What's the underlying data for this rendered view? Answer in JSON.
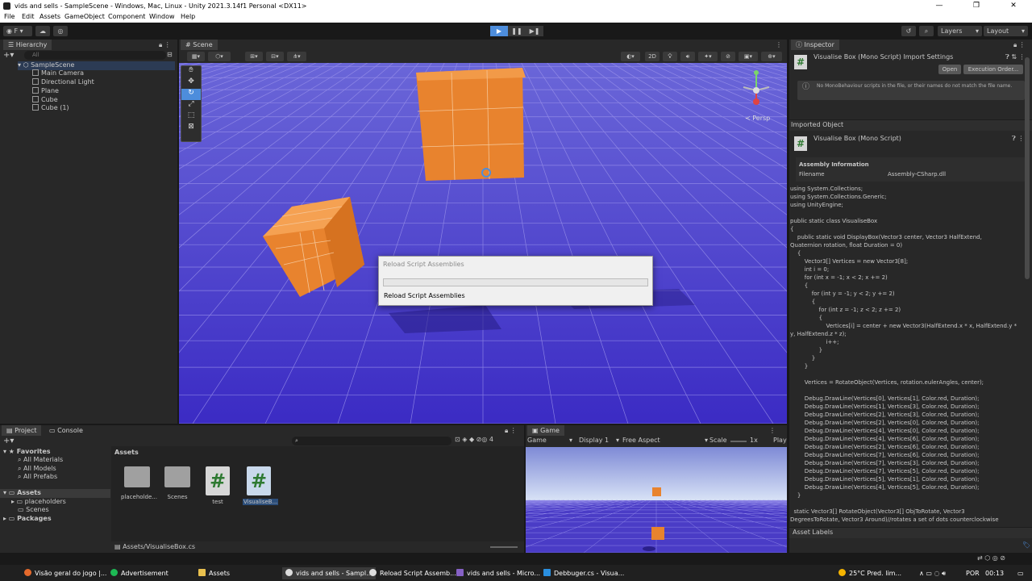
{
  "window": {
    "title": "vids and sells - SampleScene - Windows, Mac, Linux - Unity 2021.3.14f1 Personal <DX11>"
  },
  "menu": [
    "File",
    "Edit",
    "Assets",
    "GameObject",
    "Component",
    "Window",
    "Help"
  ],
  "toolbar": {
    "account": "F",
    "layers": "Layers",
    "layout": "Layout"
  },
  "hierarchy": {
    "tab": "Hierarchy",
    "search_placeholder": "All",
    "scene": "SampleScene",
    "items": [
      "Main Camera",
      "Directional Light",
      "Plane",
      "Cube",
      "Cube (1)"
    ]
  },
  "scene_view": {
    "tab": "Scene",
    "mode_2d": "2D",
    "persp": "Persp"
  },
  "dialog": {
    "title": "Reload Script Assemblies",
    "message": "Reload Script Assemblies"
  },
  "inspector": {
    "tab": "Inspector",
    "header": "Visualise Box (Mono Script) Import Settings",
    "open": "Open",
    "execution_order": "Execution Order...",
    "note": "No MonoBehaviour scripts in the file, or their names do not match the file name.",
    "imported_object": "Imported Object",
    "object_name": "Visualise Box (Mono Script)",
    "assembly_info": "Assembly Information",
    "filename_label": "Filename",
    "filename_value": "Assembly-CSharp.dll",
    "code": "using System.Collections;\nusing System.Collections.Generic;\nusing UnityEngine;\n\npublic static class VisualiseBox\n{\n    public static void DisplayBox(Vector3 center, Vector3 HalfExtend,\nQuaternion rotation, float Duration = 0)\n    {\n        Vector3[] Vertices = new Vector3[8];\n        int i = 0;\n        for (int x = -1; x < 2; x += 2)\n        {\n            for (int y = -1; y < 2; y += 2)\n            {\n                for (int z = -1; z < 2; z += 2)\n                {\n                    Vertices[i] = center + new Vector3(HalfExtend.x * x, HalfExtend.y *\ny, HalfExtend.z * z);\n                    i++;\n                }\n            }\n        }\n\n        Vertices = RotateObject(Vertices, rotation.eulerAngles, center);\n\n        Debug.DrawLine(Vertices[0], Vertices[1], Color.red, Duration);\n        Debug.DrawLine(Vertices[1], Vertices[3], Color.red, Duration);\n        Debug.DrawLine(Vertices[2], Vertices[3], Color.red, Duration);\n        Debug.DrawLine(Vertices[2], Vertices[0], Color.red, Duration);\n        Debug.DrawLine(Vertices[4], Vertices[0], Color.red, Duration);\n        Debug.DrawLine(Vertices[4], Vertices[6], Color.red, Duration);\n        Debug.DrawLine(Vertices[2], Vertices[6], Color.red, Duration);\n        Debug.DrawLine(Vertices[7], Vertices[6], Color.red, Duration);\n        Debug.DrawLine(Vertices[7], Vertices[3], Color.red, Duration);\n        Debug.DrawLine(Vertices[7], Vertices[5], Color.red, Duration);\n        Debug.DrawLine(Vertices[5], Vertices[1], Color.red, Duration);\n        Debug.DrawLine(Vertices[4], Vertices[5], Color.red, Duration);\n    }\n\n  static Vector3[] RotateObject(Vector3[] ObjToRotate, Vector3\nDegreesToRotate, Vector3 Around)//rotates a set of dots counterclockwise",
    "asset_labels": "Asset Labels"
  },
  "project": {
    "tab_project": "Project",
    "tab_console": "Console",
    "favorites": "Favorites",
    "fav_items": [
      "All Materials",
      "All Models",
      "All Prefabs"
    ],
    "assets_root": "Assets",
    "asset_children": [
      "placeholders",
      "Scenes"
    ],
    "packages": "Packages",
    "assets_header": "Assets",
    "asset_items": [
      "placeholde...",
      "Scenes",
      "test",
      "VisualiseB..."
    ],
    "path": "Assets/VisualiseBox.cs",
    "hidden_count": "4"
  },
  "game_view": {
    "tab": "Game",
    "mode": "Game",
    "display": "Display 1",
    "aspect": "Free Aspect",
    "scale_label": "Scale",
    "scale_value": "1x",
    "play": "Play"
  },
  "taskbar": {
    "items": [
      "Visão geral do jogo |...",
      "Advertisement",
      "Assets",
      "vids and sells - Sampl...",
      "Reload Script Assemb...",
      "vids and sells - Micro...",
      "Debbuger.cs - Visua..."
    ],
    "temp": "25°C",
    "weather": "Pred. lim...",
    "lang": "POR",
    "time": "00:13"
  },
  "colors": {
    "scene_bg": "#4a3cc6",
    "cube": "#e8832e",
    "accent": "#4d8ddc"
  }
}
